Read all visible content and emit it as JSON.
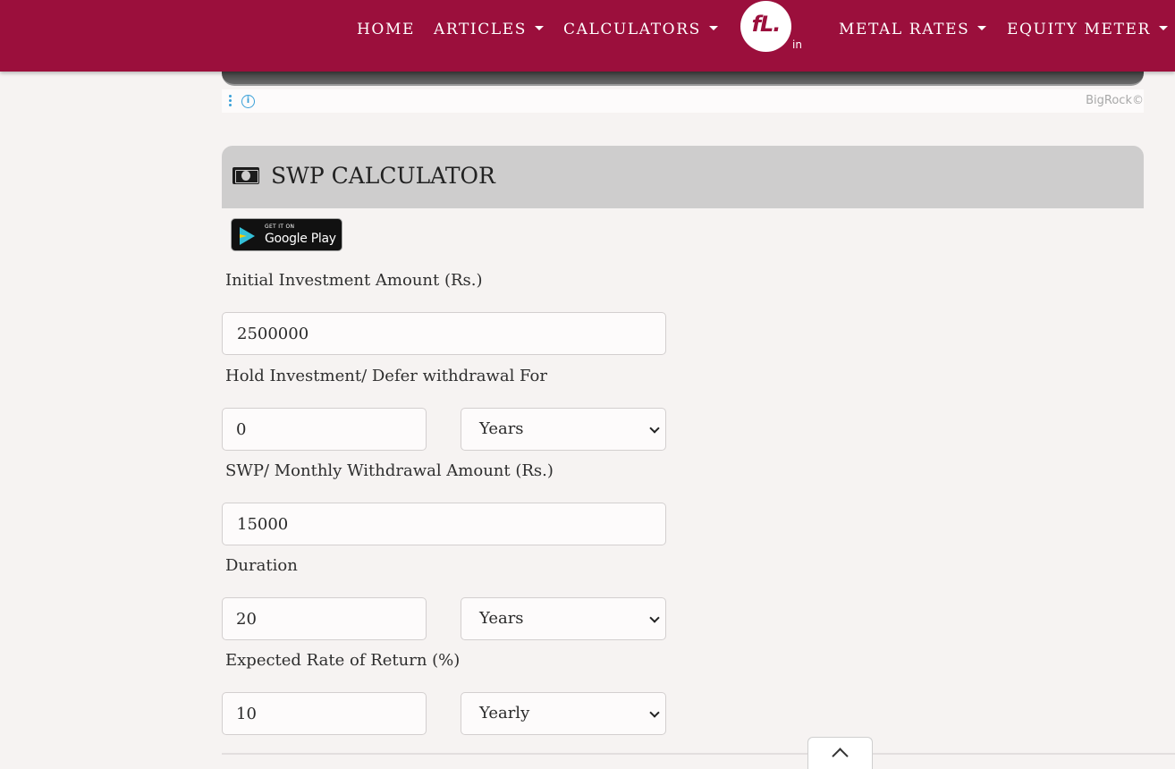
{
  "nav": {
    "items": [
      {
        "label": "HOME",
        "has_caret": false
      },
      {
        "label": "ARTICLES",
        "has_caret": true
      },
      {
        "label": "CALCULATORS",
        "has_caret": true
      },
      {
        "label": "METAL RATES",
        "has_caret": true
      },
      {
        "label": "EQUITY METER",
        "has_caret": true
      }
    ],
    "logo_text": "fL.",
    "logo_suffix": "in"
  },
  "ad": {
    "brand": "BigRock©",
    "info_icon": "i"
  },
  "calculator": {
    "title": "SWP CALCULATOR",
    "title_icon": "money-bill-icon",
    "store_badge": {
      "small_text": "GET IT ON",
      "big_text": "Google Play"
    },
    "fields": {
      "initial_investment": {
        "label": "Initial Investment Amount (Rs.)",
        "value": "2500000"
      },
      "hold_investment": {
        "label": "Hold Investment/ Defer withdrawal For",
        "value": "0",
        "unit": "Years"
      },
      "monthly_withdrawal": {
        "label": "SWP/ Monthly Withdrawal Amount (Rs.)",
        "value": "15000"
      },
      "duration": {
        "label": "Duration",
        "value": "20",
        "unit": "Years"
      },
      "rate_of_return": {
        "label": "Expected Rate of Return (%)",
        "value": "10",
        "unit": "Yearly"
      }
    }
  },
  "colors": {
    "brand": "#9b0f3c",
    "header_bg": "#cecdcd",
    "page_bg": "#f6f3f2"
  }
}
